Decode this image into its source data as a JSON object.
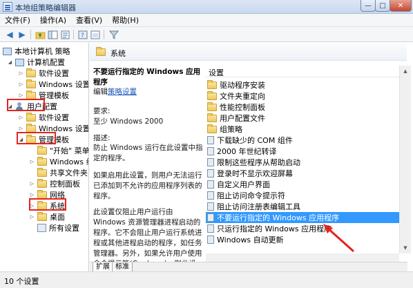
{
  "window": {
    "title": "本地组策略编辑器",
    "controls": {
      "min": "—",
      "max": "□",
      "close": "✕"
    }
  },
  "menu": [
    "文件(F)",
    "操作(A)",
    "查看(V)",
    "帮助(H)"
  ],
  "tree": {
    "root": "本地计算机 策略",
    "computer": "计算机配置",
    "computer_children": [
      "软件设置",
      "Windows 设置",
      "管理模板"
    ],
    "user": "用户配置",
    "user_children": [
      "软件设置",
      "Windows 设置",
      "管理模板"
    ],
    "admin_children": [
      "\"开始\" 菜单",
      "Windows 组件",
      "共享文件夹",
      "控制面板",
      "网络",
      "系统",
      "桌面",
      "所有设置"
    ]
  },
  "header": {
    "title": "系统"
  },
  "description": {
    "policy_title": "不要运行指定的 Windows 应用程序",
    "edit_prefix": "编辑",
    "edit_link": "策略设置",
    "req_label": "要求:",
    "req_value": "至少 Windows 2000",
    "desc_label": "描述:",
    "para1": "防止 Windows 运行在此设置中指定的程序。",
    "para2": "如果启用此设置，则用户无法运行已添加到不允许的应用程序列表的程序。",
    "para3": "此设置仅阻止用户运行由 Windows 资源管理器进程启动的程序。它不会阻止用户运行系统进程或其他进程启动的程序，如任务管理器。另外，如果允许用户使用命令提示符(Cmd.exe)，则此设"
  },
  "list": {
    "header": "设置",
    "items": [
      {
        "label": "驱动程序安装",
        "icon": "folder-icon"
      },
      {
        "label": "文件夹重定向",
        "icon": "folder-icon"
      },
      {
        "label": "性能控制面板",
        "icon": "folder-icon"
      },
      {
        "label": "用户配置文件",
        "icon": "folder-icon"
      },
      {
        "label": "组策略",
        "icon": "folder-icon"
      },
      {
        "label": "下载缺少的 COM 组件",
        "icon": "policy-icon"
      },
      {
        "label": "2000 年世纪转译",
        "icon": "policy-icon"
      },
      {
        "label": "限制这些程序从帮助启动",
        "icon": "policy-icon"
      },
      {
        "label": "登录时不显示欢迎屏幕",
        "icon": "policy-icon"
      },
      {
        "label": "自定义用户界面",
        "icon": "policy-icon"
      },
      {
        "label": "阻止访问命令提示符",
        "icon": "policy-icon"
      },
      {
        "label": "阻止访问注册表编辑工具",
        "icon": "policy-icon"
      },
      {
        "label": "不要运行指定的 Windows 应用程序",
        "icon": "policy-icon"
      },
      {
        "label": "只运行指定的 Windows 应用程序",
        "icon": "policy-icon"
      },
      {
        "label": "Windows 自动更新",
        "icon": "policy-icon"
      }
    ],
    "selected_index": 12
  },
  "tabs": [
    "扩展",
    "标准"
  ],
  "status": "10 个设置",
  "colors": {
    "selection": "#3399ff",
    "annotation": "#e5231e",
    "link": "#1a57b8"
  }
}
